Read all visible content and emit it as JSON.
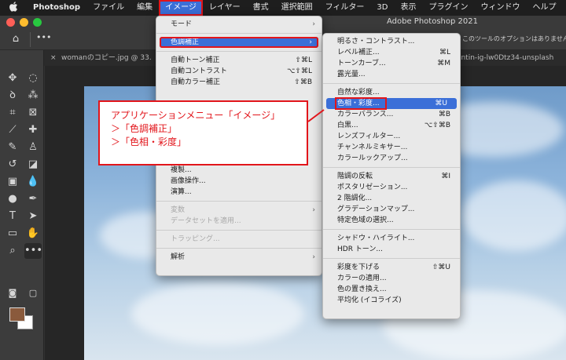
{
  "menubar": {
    "apple": "",
    "items": [
      "Photoshop",
      "ファイル",
      "編集",
      "イメージ",
      "レイヤー",
      "書式",
      "選択範囲",
      "フィルター",
      "3D",
      "表示",
      "プラグイン",
      "ウィンドウ",
      "ヘルプ"
    ]
  },
  "window": {
    "title": "Adobe Photoshop 2021"
  },
  "options_bar": {
    "more": "•••",
    "message": "このツールのオプションはありません。"
  },
  "tabs": [
    "womanのコピー.jpg @ 33.",
    "cantin-ig-lw0Dtz34-unsplash"
  ],
  "image_menu": {
    "items": [
      {
        "label": "モード",
        "shortcut": "",
        "submenu": true
      },
      {
        "label": "色調補正",
        "shortcut": "",
        "submenu": true
      },
      {
        "label": "自動トーン補正",
        "shortcut": "⇧⌘L"
      },
      {
        "label": "自動コントラスト",
        "shortcut": "⌥⇧⌘L"
      },
      {
        "label": "自動カラー補正",
        "shortcut": "⇧⌘B"
      },
      {
        "label": "複製...",
        "shortcut": ""
      },
      {
        "label": "画像操作...",
        "shortcut": ""
      },
      {
        "label": "演算...",
        "shortcut": ""
      },
      {
        "label": "変数",
        "shortcut": "",
        "submenu": true
      },
      {
        "label": "データセットを適用...",
        "shortcut": ""
      },
      {
        "label": "トラッピング...",
        "shortcut": ""
      },
      {
        "label": "解析",
        "shortcut": "",
        "submenu": true
      }
    ]
  },
  "adjust_menu": {
    "items": [
      {
        "label": "明るさ・コントラスト...",
        "shortcut": ""
      },
      {
        "label": "レベル補正...",
        "shortcut": "⌘L"
      },
      {
        "label": "トーンカーブ...",
        "shortcut": "⌘M"
      },
      {
        "label": "露光量...",
        "shortcut": ""
      },
      {
        "label": "自然な彩度...",
        "shortcut": ""
      },
      {
        "label": "色相・彩度...",
        "shortcut": "⌘U"
      },
      {
        "label": "カラーバランス...",
        "shortcut": "⌘B"
      },
      {
        "label": "白黒...",
        "shortcut": "⌥⇧⌘B"
      },
      {
        "label": "レンズフィルター...",
        "shortcut": ""
      },
      {
        "label": "チャンネルミキサー...",
        "shortcut": ""
      },
      {
        "label": "カラールックアップ...",
        "shortcut": ""
      },
      {
        "label": "階調の反転",
        "shortcut": "⌘I"
      },
      {
        "label": "ポスタリゼーション...",
        "shortcut": ""
      },
      {
        "label": "2 階調化...",
        "shortcut": ""
      },
      {
        "label": "グラデーションマップ...",
        "shortcut": ""
      },
      {
        "label": "特定色域の選択...",
        "shortcut": ""
      },
      {
        "label": "シャドウ・ハイライト...",
        "shortcut": ""
      },
      {
        "label": "HDR トーン...",
        "shortcut": ""
      },
      {
        "label": "彩度を下げる",
        "shortcut": "⇧⌘U"
      },
      {
        "label": "カラーの適用...",
        "shortcut": ""
      },
      {
        "label": "色の置き換え...",
        "shortcut": ""
      },
      {
        "label": "平均化 (イコライズ)",
        "shortcut": ""
      }
    ]
  },
  "callout": {
    "line1": "アプリケーションメニュー「イメージ」",
    "line2": "＞「色調補正」",
    "line3": "＞「色相・彩度」"
  },
  "colors": {
    "highlight": "#3b6fd8",
    "annotation_red": "#e2151b",
    "foreground_swatch": "#8a5a3c",
    "background_swatch": "#ffffff"
  }
}
